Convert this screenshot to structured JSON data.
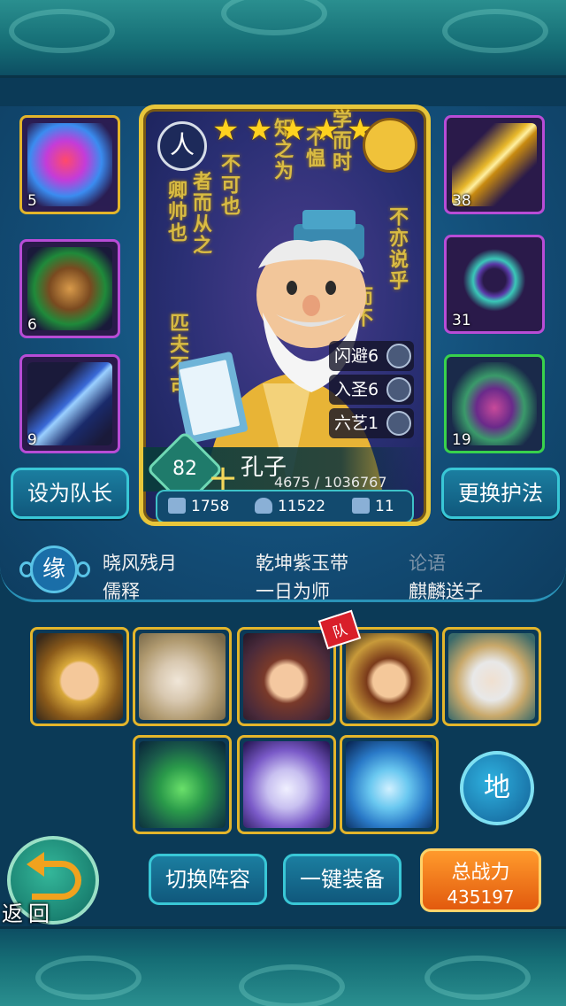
{
  "hero": {
    "level": "82",
    "name": "孔子",
    "exp": "4675 / 1036767",
    "rank_mark": "十",
    "class_badge": "人",
    "stars": 5,
    "stats": [
      {
        "label": "闪避6",
        "icon": "dodge-icon"
      },
      {
        "label": "入圣6",
        "icon": "sage-icon"
      },
      {
        "label": "六艺1",
        "icon": "arts-icon"
      }
    ],
    "attributes": [
      {
        "value": "1758",
        "icon": "book-icon"
      },
      {
        "value": "11522",
        "icon": "heart-icon"
      },
      {
        "value": "11",
        "icon": "boot-icon"
      }
    ]
  },
  "equipment": {
    "left": [
      {
        "level": "5",
        "icon": "orb-icon",
        "rarity": "gold"
      },
      {
        "level": "6",
        "icon": "bamboo-scroll-icon",
        "rarity": "purple"
      },
      {
        "level": "9",
        "icon": "staff-icon",
        "rarity": "purple"
      }
    ],
    "right": [
      {
        "level": "38",
        "icon": "golden-saber-icon",
        "rarity": "purple"
      },
      {
        "level": "31",
        "icon": "bracelet-icon",
        "rarity": "purple"
      },
      {
        "level": "19",
        "icon": "boots-icon",
        "rarity": "green"
      }
    ]
  },
  "buttons": {
    "set_captain": "设为队长",
    "change_guardian": "更换护法",
    "switch_lineup": "切换阵容",
    "one_click_equip": "一键装备",
    "back": "返回",
    "earth": "地",
    "captain_flag": "队"
  },
  "fate": {
    "icon_label": "缘",
    "items": [
      {
        "text": "晓风残月",
        "active": true
      },
      {
        "text": "乾坤紫玉带",
        "active": true
      },
      {
        "text": "论语",
        "active": false
      },
      {
        "text": "儒释",
        "active": true
      },
      {
        "text": "一日为师",
        "active": true
      },
      {
        "text": "麒麟送子",
        "active": true
      }
    ]
  },
  "power": {
    "label": "总战力",
    "value": "435197"
  },
  "party": [
    {
      "icon": "monk-hero-portrait"
    },
    {
      "icon": "confucius-hero-portrait"
    },
    {
      "icon": "lotus-maiden-portrait"
    },
    {
      "icon": "warrior-captain-portrait"
    },
    {
      "icon": "elder-sage-portrait"
    },
    {
      "icon": "green-dragon-beast-portrait"
    },
    {
      "icon": "white-tiger-beast-portrait"
    },
    {
      "icon": "azure-qilin-beast-portrait"
    }
  ],
  "colors": {
    "card_border": "#e8c63a",
    "button_border": "#39c7d6",
    "power_orange": "#e25a0e"
  }
}
